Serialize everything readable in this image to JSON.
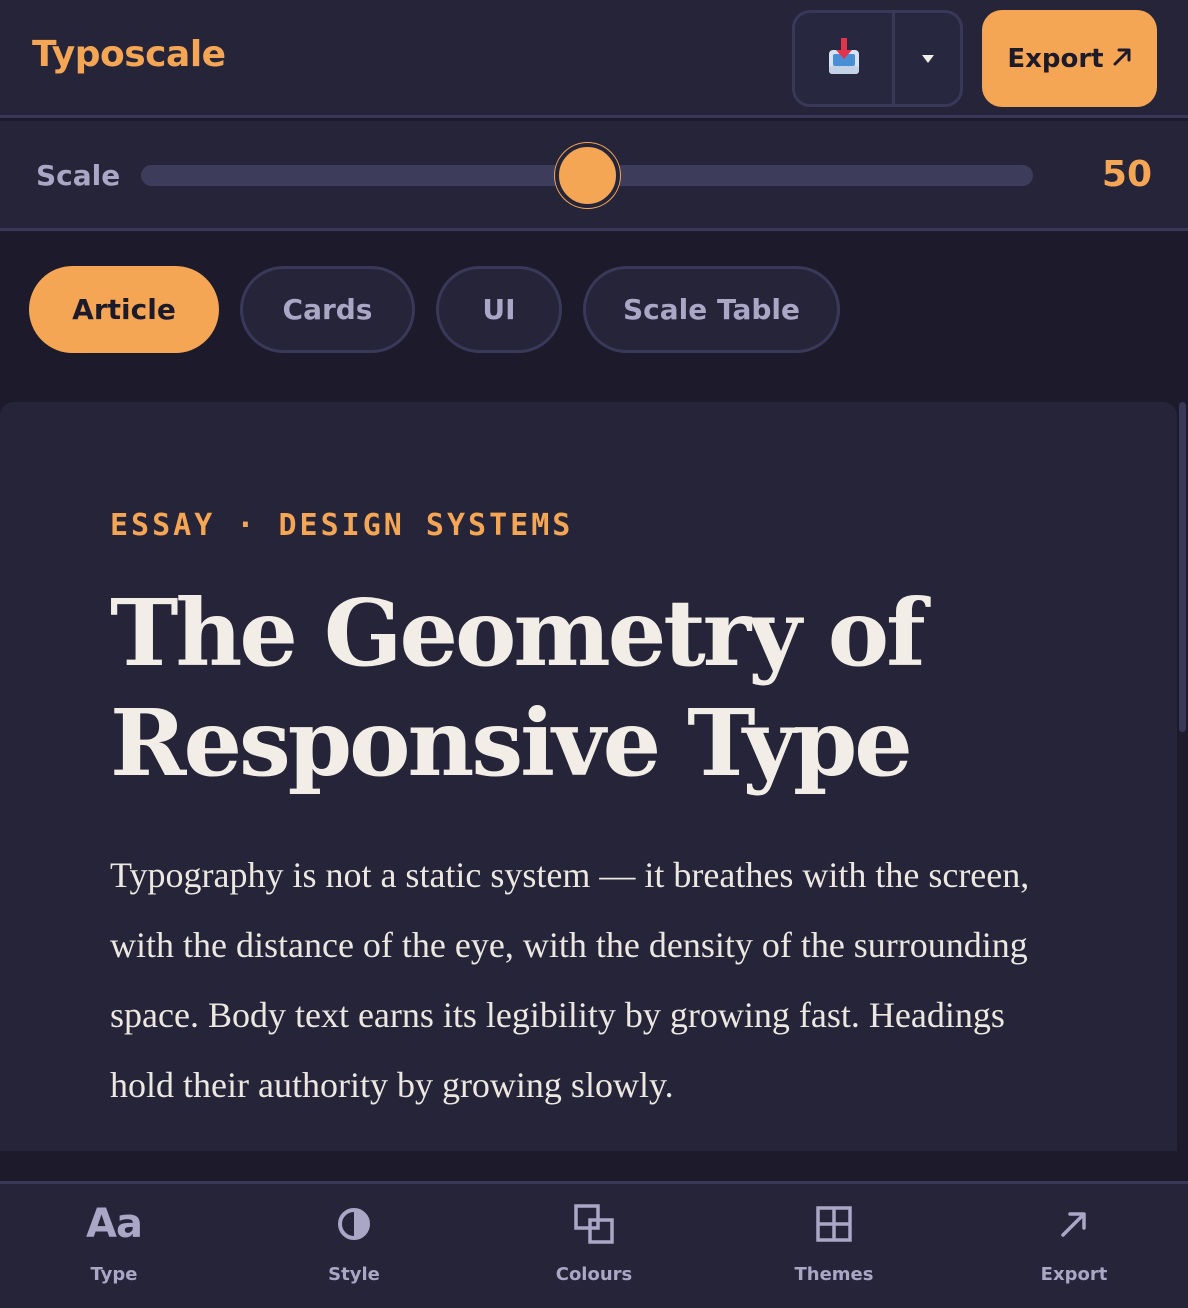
{
  "app": {
    "title": "Typoscale"
  },
  "header": {
    "split_button_icon": "inbox-download-icon",
    "split_caret_icon": "caret-down-icon",
    "export_label": "Export",
    "export_icon": "arrow-up-right-icon"
  },
  "scale": {
    "label": "Scale",
    "value": "50",
    "min": 0,
    "max": 100
  },
  "tabs": [
    {
      "label": "Article",
      "active": true
    },
    {
      "label": "Cards",
      "active": false
    },
    {
      "label": "UI",
      "active": false
    },
    {
      "label": "Scale Table",
      "active": false
    }
  ],
  "article": {
    "eyebrow": "ESSAY · DESIGN SYSTEMS",
    "headline": "The Geometry of Responsive Type",
    "body": "Typography is not a static system — it breathes with the screen, with the distance of the eye, with the density of the surrounding space. Body text earns its legibility by growing fast. Headings hold their authority by growing slowly."
  },
  "bottom_nav": [
    {
      "label": "Type",
      "icon": "type-aa-icon"
    },
    {
      "label": "Style",
      "icon": "contrast-icon"
    },
    {
      "label": "Colours",
      "icon": "overlap-squares-icon"
    },
    {
      "label": "Themes",
      "icon": "grid-icon"
    },
    {
      "label": "Export",
      "icon": "arrow-up-right-icon"
    }
  ],
  "colors": {
    "accent": "#f4a655",
    "background": "#1d1b2b",
    "surface": "#252439",
    "muted_text": "#a9a6c6"
  }
}
